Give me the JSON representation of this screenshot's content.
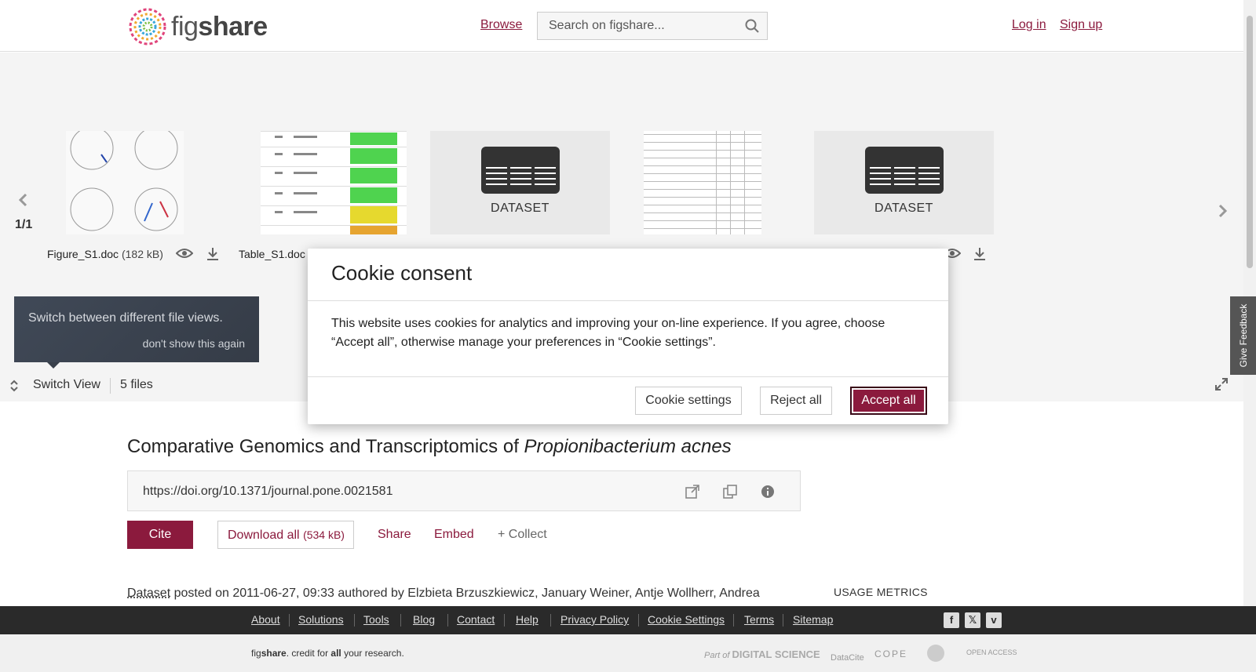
{
  "header": {
    "logo_text_light": "fig",
    "logo_text_bold": "share",
    "browse": "Browse",
    "search_placeholder": "Search on figshare...",
    "login": "Log in",
    "signup": "Sign up"
  },
  "viewer": {
    "pager": "1/1",
    "files": [
      {
        "name": "Figure_S1.doc",
        "size": "(182 kB)"
      },
      {
        "name": "Table_S1.doc",
        "size": ""
      }
    ],
    "dataset_label": "DATASET",
    "tooltip_text": "Switch between different file views.",
    "tooltip_dismiss": "don't show this again",
    "switch_view": "Switch View",
    "files_count": "5 files"
  },
  "article": {
    "title_plain": "Comparative Genomics and Transcriptomics of ",
    "title_italic": "Propionibacterium acnes",
    "doi": "https://doi.org/10.1371/journal.pone.0021581",
    "cite": "Cite",
    "download_all": "Download all",
    "download_size": "(534 kB)",
    "share": "Share",
    "embed": "Embed",
    "collect": "+ Collect",
    "item_type": "Dataset",
    "posted_text": " posted on 2011-06-27, 09:33 authored by Elzbieta Brzuszkiewicz, January Weiner, Antje Wollherr, Andrea",
    "usage_metrics": "USAGE METRICS"
  },
  "footer": {
    "links": [
      "About",
      "Solutions",
      "Tools",
      "Blog",
      "Contact",
      "Help",
      "Privacy Policy",
      "Cookie Settings",
      "Terms",
      "Sitemap"
    ],
    "tagline_fig": "fig",
    "tagline_share": "share",
    "tagline_mid": ". credit for ",
    "tagline_all": "all",
    "tagline_end": " your research.",
    "partner_part_of": "Part of",
    "partner_ds": "DIGITAL SCIENCE",
    "partner_datacite": "DataCite",
    "partner_cope": "COPE",
    "partner_oa": "OPEN ACCESS"
  },
  "feedback": "Give Feedback",
  "cookie": {
    "title": "Cookie consent",
    "body": "This website uses cookies for analytics and improving your on-line experience. If you agree, choose “Accept all”, otherwise manage your preferences in “Cookie settings”.",
    "settings": "Cookie settings",
    "reject": "Reject all",
    "accept": "Accept all"
  },
  "colors": {
    "brand": "#8b1a3d",
    "footer_dark": "#2a2a2a",
    "tooltip": "#3d4552"
  }
}
